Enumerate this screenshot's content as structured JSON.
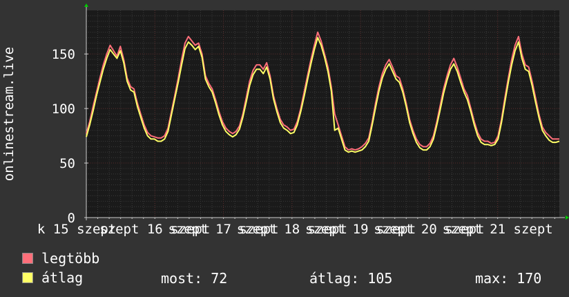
{
  "chart_data": {
    "type": "line",
    "ylabel": "onlinestream.live",
    "ylim": [
      0,
      190
    ],
    "yticks": [
      0,
      50,
      100,
      150
    ],
    "xlim": [
      0,
      6.9
    ],
    "xticks": [
      {
        "pos": -0.14,
        "label": "k 15 szept"
      },
      {
        "pos": 1.0,
        "label": "szept 16 szept"
      },
      {
        "pos": 2.0,
        "label": "szept 17 szept"
      },
      {
        "pos": 3.0,
        "label": "szept 18 szept"
      },
      {
        "pos": 4.0,
        "label": "szept 19 szept"
      },
      {
        "pos": 5.0,
        "label": "szept 20 szept"
      },
      {
        "pos": 6.0,
        "label": "szept 21 szept"
      }
    ],
    "series": [
      {
        "name": "legtöbb",
        "color": "#ff6f7a",
        "values": [
          77,
          88,
          102,
          115,
          128,
          140,
          150,
          158,
          153,
          148,
          157,
          145,
          128,
          120,
          118,
          105,
          95,
          85,
          78,
          75,
          74,
          73,
          73,
          75,
          82,
          97,
          112,
          128,
          145,
          160,
          166,
          162,
          158,
          160,
          150,
          130,
          123,
          118,
          108,
          97,
          88,
          82,
          79,
          77,
          79,
          84,
          95,
          110,
          125,
          135,
          140,
          140,
          136,
          142,
          130,
          112,
          100,
          90,
          85,
          83,
          80,
          81,
          88,
          100,
          115,
          130,
          145,
          158,
          170,
          162,
          150,
          138,
          120,
          95,
          85,
          75,
          65,
          62,
          63,
          62,
          63,
          65,
          68,
          73,
          88,
          105,
          120,
          132,
          140,
          145,
          138,
          130,
          128,
          118,
          105,
          90,
          80,
          72,
          67,
          65,
          65,
          68,
          75,
          88,
          103,
          118,
          130,
          140,
          146,
          138,
          128,
          118,
          112,
          100,
          88,
          78,
          72,
          70,
          70,
          68,
          69,
          75,
          90,
          110,
          128,
          145,
          158,
          166,
          150,
          140,
          138,
          125,
          110,
          95,
          83,
          78,
          75,
          72,
          72,
          72
        ]
      },
      {
        "name": "átlag",
        "color": "#ffff66",
        "values": [
          74,
          85,
          98,
          112,
          124,
          136,
          146,
          154,
          150,
          146,
          153,
          142,
          125,
          117,
          115,
          102,
          92,
          82,
          75,
          72,
          72,
          70,
          70,
          72,
          79,
          94,
          109,
          124,
          140,
          155,
          161,
          158,
          154,
          157,
          147,
          127,
          120,
          115,
          105,
          94,
          85,
          79,
          76,
          74,
          76,
          81,
          92,
          106,
          121,
          131,
          136,
          136,
          132,
          138,
          127,
          109,
          97,
          87,
          82,
          80,
          77,
          78,
          85,
          97,
          111,
          126,
          141,
          154,
          165,
          158,
          147,
          134,
          116,
          80,
          82,
          72,
          62,
          60,
          61,
          60,
          61,
          62,
          65,
          70,
          85,
          101,
          116,
          128,
          136,
          141,
          134,
          127,
          124,
          115,
          102,
          87,
          77,
          69,
          64,
          62,
          62,
          65,
          72,
          85,
          99,
          114,
          126,
          136,
          141,
          134,
          124,
          115,
          108,
          97,
          85,
          75,
          69,
          67,
          67,
          66,
          67,
          72,
          87,
          106,
          124,
          140,
          153,
          161,
          146,
          136,
          134,
          121,
          106,
          92,
          80,
          75,
          71,
          69,
          69,
          70
        ]
      }
    ]
  },
  "legend": {
    "items": [
      {
        "label": "legtöbb",
        "color": "#ff6f7a"
      },
      {
        "label": "átlag",
        "color": "#ffff66"
      }
    ]
  },
  "stats": {
    "now": "most: 72",
    "avg": "átlag: 105",
    "max": "max: 170"
  },
  "colors": {
    "background": "#333333",
    "plot_background": "#1a1a1a",
    "grid_minor": "#3a3a3a",
    "grid_major": "#5a2a2a",
    "axis": "#cccccc",
    "arrow": "#00cc00"
  }
}
